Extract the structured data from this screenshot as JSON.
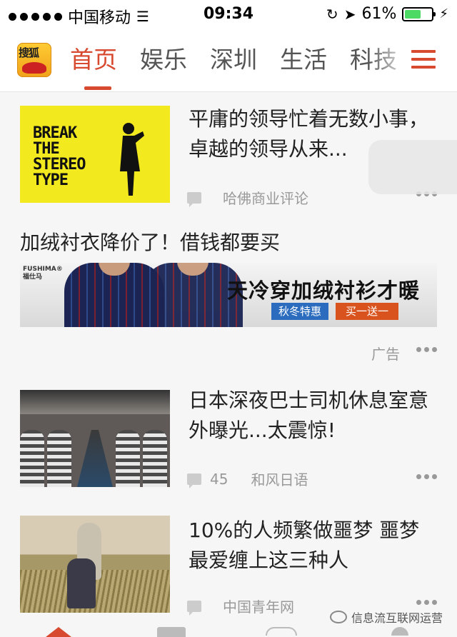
{
  "status_bar": {
    "carrier": "中国移动",
    "time": "09:34",
    "battery": "61%",
    "battery_level": 0.61
  },
  "nav": {
    "logo_text": "搜狐",
    "tabs": [
      "首页",
      "娱乐",
      "深圳",
      "生活",
      "科技"
    ],
    "active_tab": "首页"
  },
  "articles": [
    {
      "title": "平庸的领导忙着无数小事，卓越的领导从来...",
      "source": "哈佛商业评论",
      "comments": "",
      "thumb_text": "BREAK\nTHE\nSTEREO\nTYPE"
    },
    {
      "title": "日本深夜巴士司机休息室意外曝光...太震惊!",
      "source": "和风日语",
      "comments": "45"
    },
    {
      "title": "10%的人频繁做噩梦 噩梦最爱缠上这三种人",
      "source": "中国青年网",
      "comments": ""
    }
  ],
  "ad": {
    "title": "加绒衬衣降价了！借钱都要买",
    "brand": "FUSHIMA®\n福仕马",
    "slogan": "天冷穿加绒衬衫才暖",
    "tag1": "秋冬特惠",
    "tag2": "买一送一",
    "label": "广告"
  },
  "watermark": "信息流互联网运营",
  "colors": {
    "accent": "#d84a2f",
    "battery": "#4cd964",
    "ad_tag_blue": "#2b6cbf",
    "ad_tag_orange": "#d9531e"
  }
}
